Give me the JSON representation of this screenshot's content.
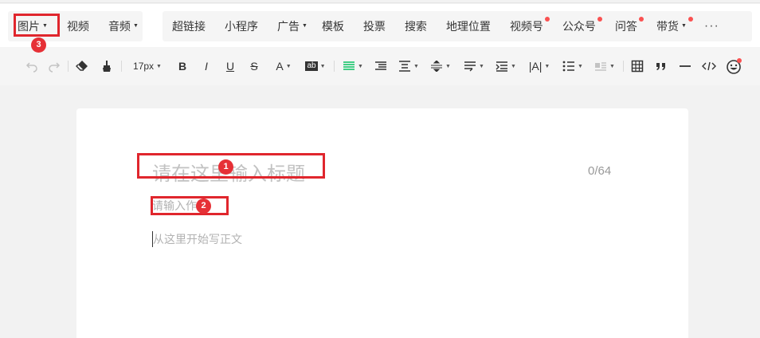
{
  "menu": {
    "group1": [
      {
        "label": "图片",
        "caret": true
      },
      {
        "label": "视频",
        "caret": false
      },
      {
        "label": "音频",
        "caret": true
      }
    ],
    "group2": [
      {
        "label": "超链接",
        "caret": false,
        "dot": false
      },
      {
        "label": "小程序",
        "caret": false,
        "dot": false
      },
      {
        "label": "广告",
        "caret": true,
        "dot": false
      },
      {
        "label": "模板",
        "caret": false,
        "dot": false
      },
      {
        "label": "投票",
        "caret": false,
        "dot": false
      },
      {
        "label": "搜索",
        "caret": false,
        "dot": false
      },
      {
        "label": "地理位置",
        "caret": false,
        "dot": false
      },
      {
        "label": "视频号",
        "caret": false,
        "dot": true
      },
      {
        "label": "公众号",
        "caret": false,
        "dot": true
      },
      {
        "label": "问答",
        "caret": false,
        "dot": true
      },
      {
        "label": "带货",
        "caret": true,
        "dot": true
      }
    ],
    "more_label": "···"
  },
  "toolbar": {
    "font_size": "17px",
    "bold_label": "B",
    "italic_label": "I",
    "underline_label": "U",
    "strike_label": "S",
    "font_color_label": "A",
    "bg_color_label": "ab",
    "letter_spacing_label": "|A|"
  },
  "editor": {
    "title_placeholder": "请在这里输入标题",
    "title_counter": "0/64",
    "author_placeholder": "请输入作者",
    "body_placeholder": "从这里开始写正文"
  },
  "annotations": {
    "badge_1": "1",
    "badge_2": "2",
    "badge_3": "3"
  },
  "colors": {
    "accent_green": "#07c160",
    "highlight_red": "#e0262d",
    "notify_dot": "#fa5151"
  }
}
